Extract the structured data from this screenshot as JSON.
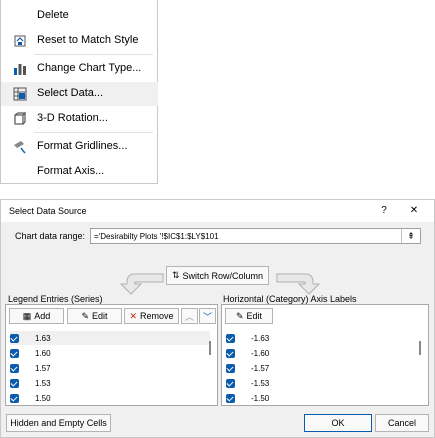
{
  "menu": {
    "items": [
      {
        "label": "Delete",
        "icon": "delete-icon"
      },
      {
        "label": "Reset to Match Style",
        "icon": "reset-style-icon"
      },
      {
        "label": "Change Chart Type...",
        "icon": "chart-type-icon"
      },
      {
        "label": "Select Data...",
        "icon": "select-data-icon"
      },
      {
        "label": "3-D Rotation...",
        "icon": "rotation-3d-icon"
      },
      {
        "label": "Format Gridlines...",
        "icon": "format-gridlines-icon"
      },
      {
        "label": "Format Axis...",
        "icon": ""
      }
    ]
  },
  "dialog": {
    "title": "Select Data Source",
    "help": "?",
    "close": "✕",
    "range_label": "Chart data range:",
    "range_value": "='Desirabilty Plots '!$IC$1:$LY$101",
    "switch_label": "Switch Row/Column",
    "legend_title": "Legend Entries (Series)",
    "axis_title": "Horizontal (Category) Axis Labels",
    "add_label": "Add",
    "edit_label": "Edit",
    "remove_label": "Remove",
    "axis_edit_label": "Edit",
    "series": [
      "1.63",
      "1.60",
      "1.57",
      "1.53",
      "1.50"
    ],
    "categories": [
      "-1.63",
      "-1.60",
      "-1.57",
      "-1.53",
      "-1.50"
    ],
    "hidden_label": "Hidden and Empty Cells",
    "ok_label": "OK",
    "cancel_label": "Cancel"
  },
  "colors": {
    "accent": "#0b5cad",
    "highlight": "#f0f0f0"
  }
}
